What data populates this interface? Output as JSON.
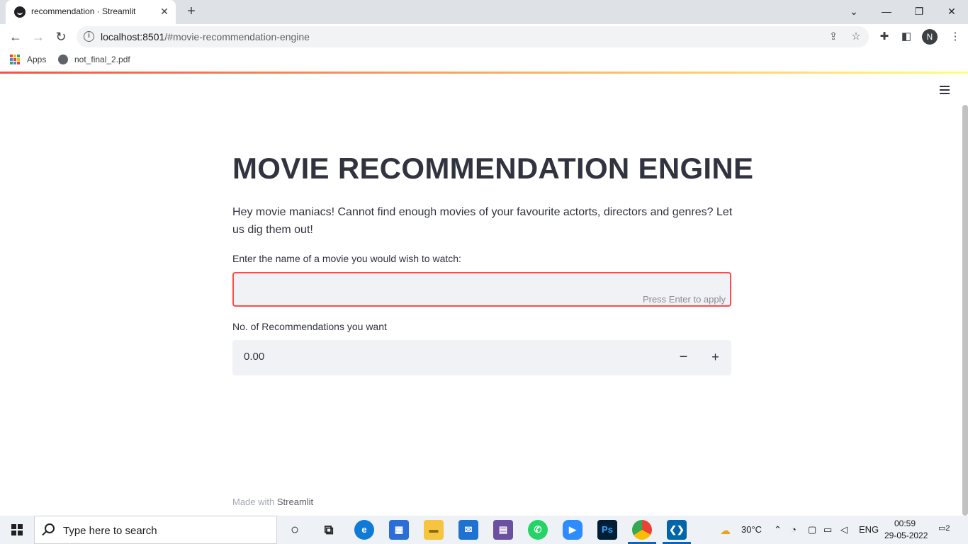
{
  "browser": {
    "tab_title": "recommendation · Streamlit",
    "tab_close": "✕",
    "new_tab": "+",
    "window_controls": {
      "dropdown": "⌄",
      "minimize": "—",
      "restore": "❐",
      "close": "✕"
    },
    "url_host": "localhost:8501",
    "url_path": "/#movie-recommendation-engine",
    "profile_initial": "N",
    "bookmarks": [
      {
        "label": "Apps"
      },
      {
        "label": "not_final_2.pdf"
      }
    ]
  },
  "app": {
    "title": "MOVIE RECOMMENDATION ENGINE",
    "intro": "Hey movie maniacs! Cannot find enough movies of your favourite actorts, directors and genres? Let us dig them out!",
    "movie_input": {
      "label": "Enter the name of a movie you would wish to watch:",
      "value": "",
      "hint": "Press Enter to apply"
    },
    "number_input": {
      "label": "No. of Recommendations you want",
      "value": "0.00",
      "minus": "−",
      "plus": "+"
    },
    "footer": {
      "prefix": "Made with ",
      "link": "Streamlit"
    }
  },
  "taskbar": {
    "search_placeholder": "Type here to search",
    "weather": "30°C",
    "language": "ENG",
    "time": "00:59",
    "date": "29-05-2022",
    "notification_count": "2",
    "apps": [
      "task-view",
      "widgets",
      "edge",
      "store",
      "file-explorer",
      "mail",
      "media-app",
      "whatsapp",
      "zoom",
      "photoshop",
      "chrome",
      "vscode"
    ]
  },
  "colors": {
    "accent": "#ff4b4b",
    "text": "#31333f",
    "input_bg": "#f0f2f6",
    "taskbar_bg": "#eef1f5"
  }
}
